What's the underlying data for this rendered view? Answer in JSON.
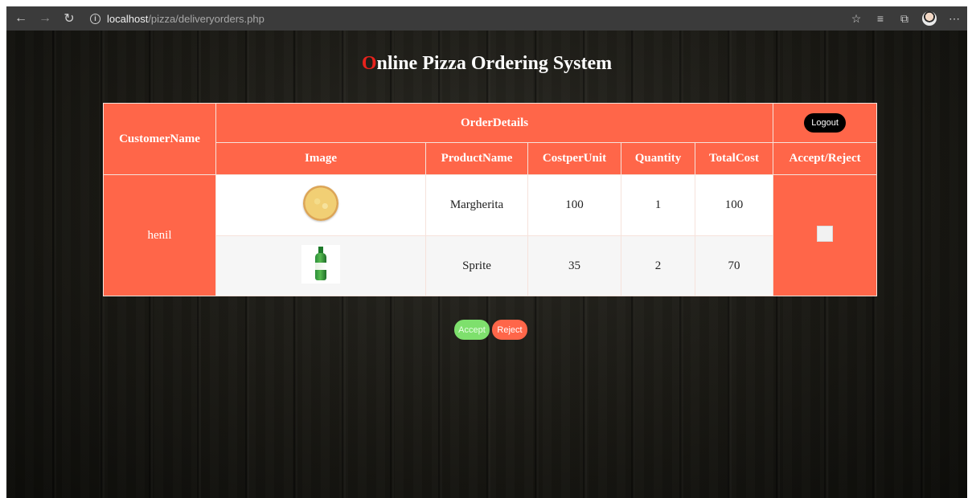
{
  "browser": {
    "url_host": "localhost",
    "url_path": "/pizza/deliveryorders.php",
    "icons": [
      "back-arrow-icon",
      "forward-arrow-icon",
      "refresh-icon",
      "info-icon",
      "favorite-star-icon",
      "favorites-list-icon",
      "collections-icon",
      "profile-avatar",
      "more-options-icon"
    ]
  },
  "page": {
    "title_first_letter": "O",
    "title_rest": "nline Pizza Ordering System"
  },
  "table": {
    "headers": {
      "customer_name": "CustomerName",
      "order_details": "OrderDetails",
      "logout": "Logout",
      "image": "Image",
      "product_name": "ProductName",
      "cost_per_unit": "CostperUnit",
      "quantity": "Quantity",
      "total_cost": "TotalCost",
      "accept_reject": "Accept/Reject"
    },
    "order": {
      "customer": "henil",
      "items": [
        {
          "image": "pizza-image",
          "product": "Margherita",
          "cost": "100",
          "quantity": "1",
          "total": "100"
        },
        {
          "image": "sprite-bottle-image",
          "product": "Sprite",
          "cost": "35",
          "quantity": "2",
          "total": "70"
        }
      ]
    }
  },
  "actions": {
    "accept_label": "Accept",
    "reject_label": "Reject"
  },
  "colors": {
    "accent": "#ff6649",
    "title_highlight": "#e8221c",
    "accept": "#7ee06d",
    "background": "#1a1914"
  }
}
